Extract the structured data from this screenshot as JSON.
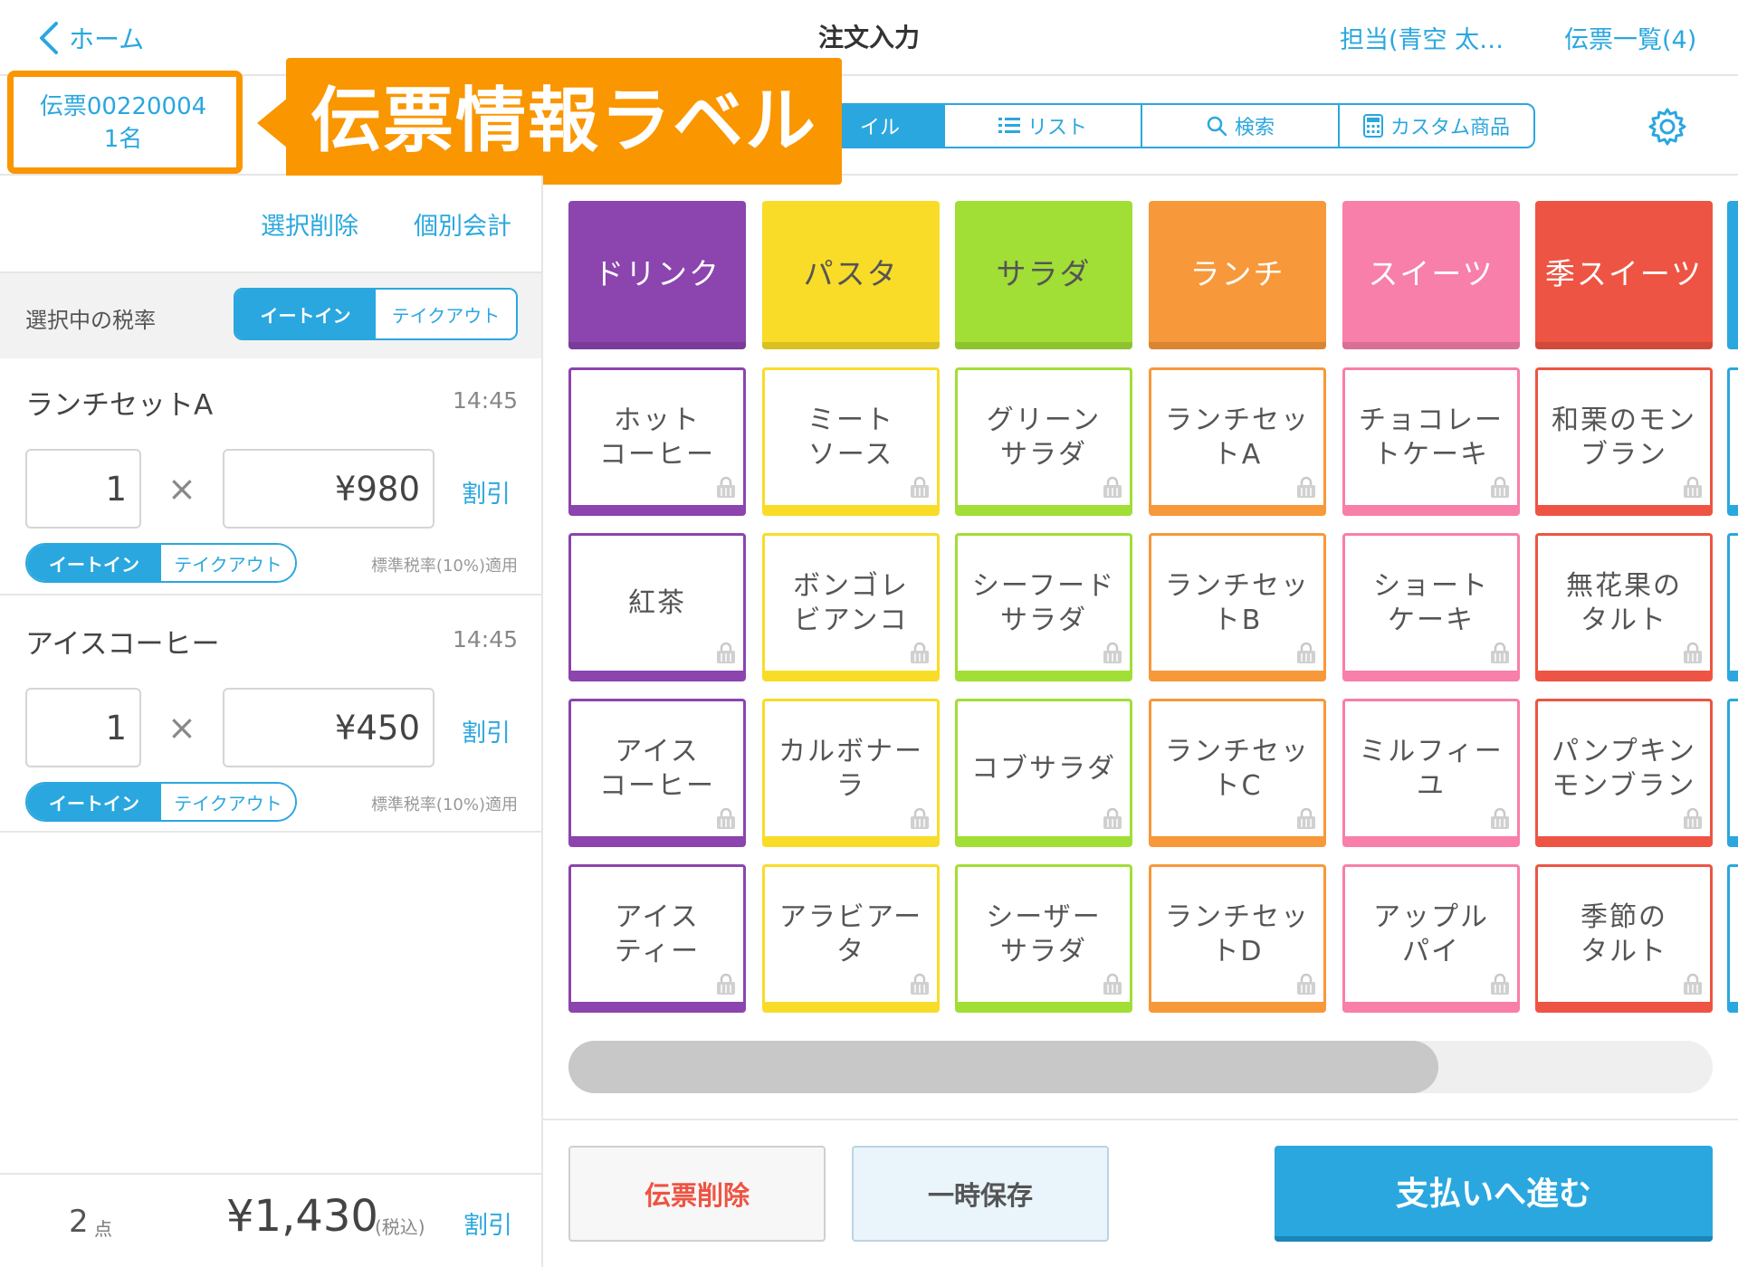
{
  "nav": {
    "back_label": "ホーム",
    "title": "注文入力",
    "staff": "担当(青空 太…",
    "slips": "伝票一覧(4)"
  },
  "slip": {
    "number": "伝票00220004",
    "guests": "1名"
  },
  "callout": "伝票情報ラベル",
  "view_tabs": [
    {
      "label": "タイル",
      "visible_text": "イル",
      "icon": "tile-icon",
      "active": true
    },
    {
      "label": "リスト",
      "icon": "list-icon",
      "active": false
    },
    {
      "label": "検索",
      "icon": "search-icon",
      "active": false
    },
    {
      "label": "カスタム商品",
      "icon": "calculator-icon",
      "active": false
    }
  ],
  "left": {
    "delete_selected": "選択削除",
    "split_bill": "個別会計",
    "tax_rate_label": "選択中の税率",
    "eat_in": "イートイン",
    "take_out": "テイクアウト",
    "discount": "割引",
    "times": "×",
    "items": [
      {
        "name": "ランチセットA",
        "time": "14:45",
        "qty": "1",
        "price": "¥980",
        "tax_note": "標準税率(10%)適用"
      },
      {
        "name": "アイスコーヒー",
        "time": "14:45",
        "qty": "1",
        "price": "¥450",
        "tax_note": "標準税率(10%)適用"
      }
    ],
    "footer": {
      "count": "2",
      "count_unit": "点",
      "total": "¥1,430",
      "tax_incl": "(税込)",
      "discount": "割引"
    }
  },
  "colors": {
    "accent": "#2aa7df",
    "callout": "#fa9600",
    "drink": "#8c44ae",
    "pasta": "#f9dc28",
    "salad": "#a1de36",
    "lunch": "#f7983a",
    "sweets": "#f77fa9",
    "seasonal": "#ee5443"
  },
  "categories": [
    {
      "label": "ドリンク",
      "color": "#8c44ae",
      "text": "#ffffff"
    },
    {
      "label": "パスタ",
      "color": "#f9dc28",
      "text": "#555555"
    },
    {
      "label": "サラダ",
      "color": "#a1de36",
      "text": "#555555"
    },
    {
      "label": "ランチ",
      "color": "#f7983a",
      "text": "#ffffff"
    },
    {
      "label": "スイーツ",
      "color": "#f77fa9",
      "text": "#ffffff"
    },
    {
      "label": "季スイーツ",
      "color": "#ee5443",
      "text": "#ffffff"
    }
  ],
  "products": [
    [
      {
        "l1": "ホット",
        "l2": "コーヒー"
      },
      {
        "l1": "ミート",
        "l2": "ソース"
      },
      {
        "l1": "グリーン",
        "l2": "サラダ"
      },
      {
        "l1": "ランチセッ",
        "l2": "トA"
      },
      {
        "l1": "チョコレー",
        "l2": "トケーキ"
      },
      {
        "l1": "和栗のモン",
        "l2": "ブラン"
      }
    ],
    [
      {
        "l1": "紅茶",
        "l2": ""
      },
      {
        "l1": "ボンゴレ",
        "l2": "ビアンコ"
      },
      {
        "l1": "シーフード",
        "l2": "サラダ"
      },
      {
        "l1": "ランチセッ",
        "l2": "トB"
      },
      {
        "l1": "ショート",
        "l2": "ケーキ"
      },
      {
        "l1": "無花果の",
        "l2": "タルト"
      }
    ],
    [
      {
        "l1": "アイス",
        "l2": "コーヒー"
      },
      {
        "l1": "カルボナー",
        "l2": "ラ"
      },
      {
        "l1": "コブサラダ",
        "l2": ""
      },
      {
        "l1": "ランチセッ",
        "l2": "トC"
      },
      {
        "l1": "ミルフィー",
        "l2": "ユ"
      },
      {
        "l1": "パンプキン",
        "l2": "モンブラン"
      }
    ],
    [
      {
        "l1": "アイス",
        "l2": "ティー"
      },
      {
        "l1": "アラビアー",
        "l2": "タ"
      },
      {
        "l1": "シーザー",
        "l2": "サラダ"
      },
      {
        "l1": "ランチセッ",
        "l2": "トD"
      },
      {
        "l1": "アップル",
        "l2": "パイ"
      },
      {
        "l1": "季節の",
        "l2": "タルト"
      }
    ]
  ],
  "scroll": {
    "position": 0.0,
    "visible_fraction": 0.76
  },
  "bottom": {
    "delete_slip": "伝票削除",
    "hold": "一時保存",
    "pay": "支払いへ進む"
  }
}
